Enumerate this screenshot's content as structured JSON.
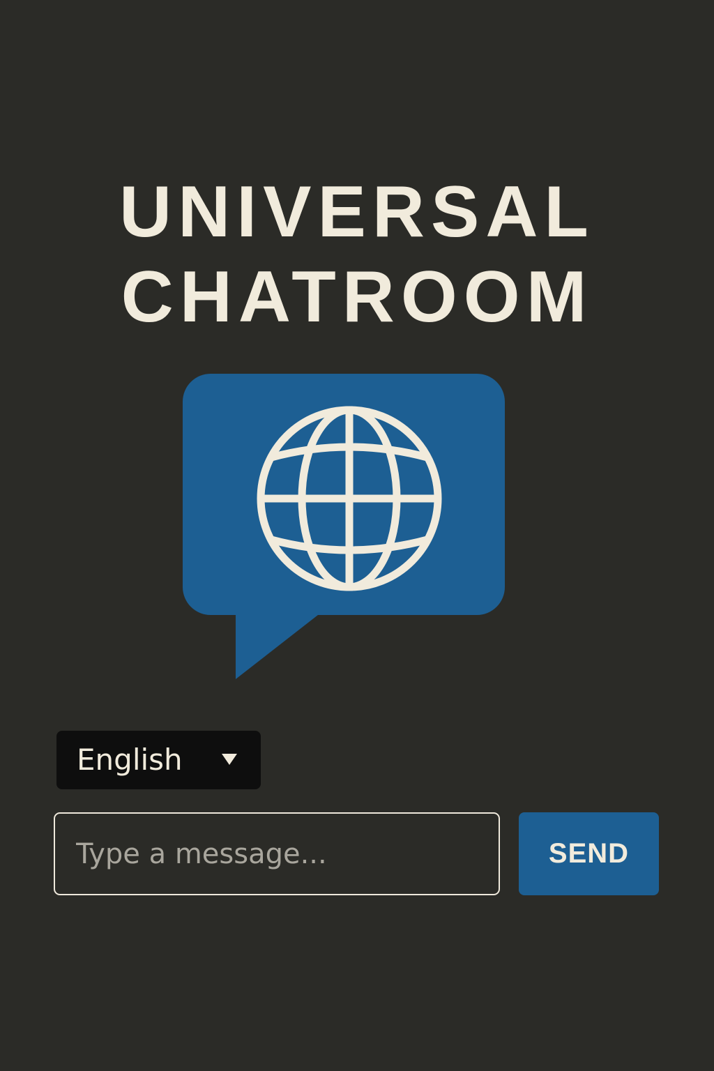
{
  "header": {
    "title_line_1": "UNIVERSAL",
    "title_line_2": "CHATROOM"
  },
  "logo": {
    "icon": "globe-chat-bubble-icon",
    "bubble_color": "#1d5f93",
    "globe_color": "#f1ebdc"
  },
  "language_selector": {
    "selected": "English",
    "icon": "caret-down-icon"
  },
  "composer": {
    "placeholder": "Type a message...",
    "value": "",
    "send_label": "SEND"
  },
  "colors": {
    "background": "#2b2b27",
    "accent": "#1d5f93",
    "text": "#f1ebdc"
  }
}
